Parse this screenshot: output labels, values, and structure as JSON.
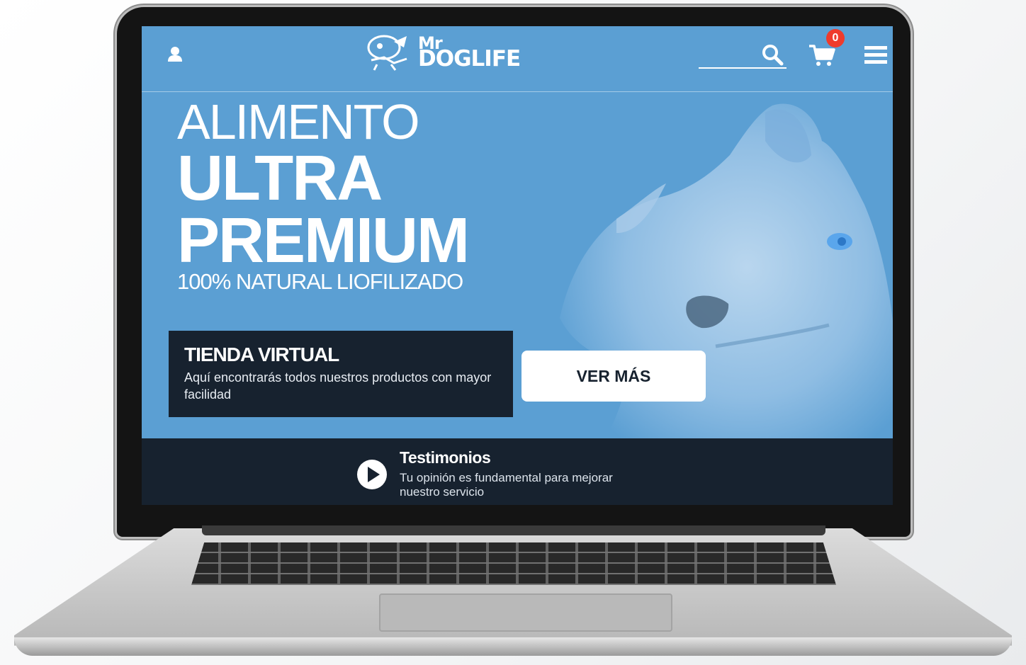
{
  "header": {
    "logo_mr": "Mr",
    "logo_word": "DOGLIFE",
    "search_placeholder": "",
    "cart_count": "0"
  },
  "hero": {
    "line1": "ALIMENTO",
    "line2": "ULTRA",
    "line3": "PREMIUM",
    "subtitle": "100% NATURAL LIOFILIZADO"
  },
  "store": {
    "title": "TIENDA VIRTUAL",
    "text": "Aquí encontrarás todos nuestros productos con mayor facilidad",
    "button_label": "VER MÁS"
  },
  "testimonials": {
    "title": "Testimonios",
    "text": "Tu opinión es fundamental para mejorar nuestro servicio"
  },
  "colors": {
    "hero_blue": "#5b9fd3",
    "dark_panel": "#17222f",
    "badge_red": "#ef3b2c"
  },
  "icons": [
    "user-icon",
    "search-icon",
    "cart-icon",
    "menu-icon",
    "play-icon"
  ]
}
